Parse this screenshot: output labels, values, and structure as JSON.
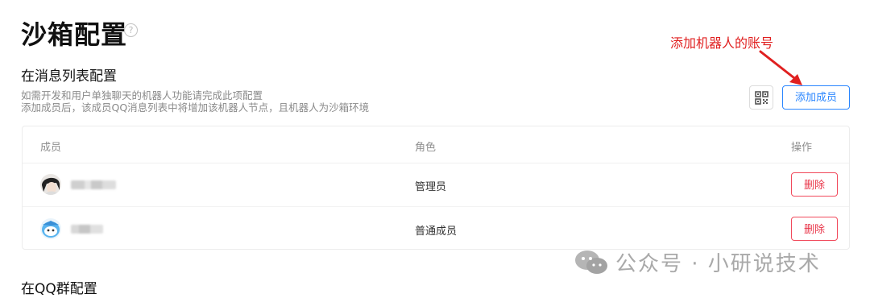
{
  "page": {
    "title": "沙箱配置",
    "help_glyph": "?"
  },
  "annotation": {
    "text": "添加机器人的账号",
    "color": "#e02020"
  },
  "message_list_section": {
    "title": "在消息列表配置",
    "desc_line1": "如需开发和用户单独聊天的机器人功能请完成此项配置",
    "desc_line2": "添加成员后，该成员QQ消息列表中将增加该机器人节点，且机器人为沙箱环境",
    "qr_icon": "qr-code-icon",
    "add_button_label": "添加成员"
  },
  "table": {
    "columns": {
      "member": "成员",
      "role": "角色",
      "action": "操作"
    },
    "rows": [
      {
        "role": "管理员",
        "delete_label": "删除",
        "avatar_icon": "dark-hair-avatar"
      },
      {
        "role": "普通成员",
        "delete_label": "删除",
        "avatar_icon": "blue-character-avatar"
      }
    ]
  },
  "group_section": {
    "title": "在QQ群配置"
  },
  "watermark": {
    "text": "公众号 · 小研说技术",
    "icon": "wechat-icon"
  },
  "colors": {
    "accent": "#2a86ff",
    "danger": "#e9364a",
    "annotation": "#e02020"
  }
}
